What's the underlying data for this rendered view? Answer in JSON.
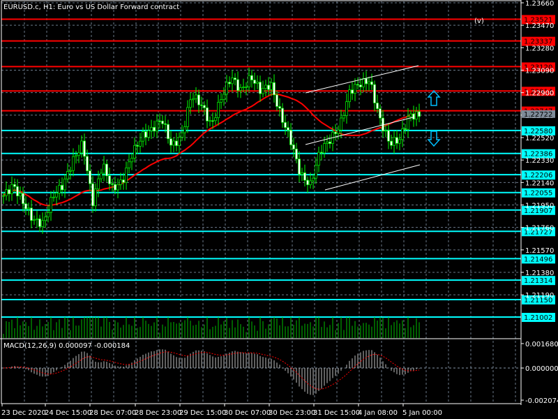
{
  "header": {
    "title": "EURUSD.c, H1:  Euro vs US Dollar Forward contract",
    "mode_indicator": "(v)"
  },
  "price_axis": {
    "ticks": [
      "1.23660",
      "1.23470",
      "1.23280",
      "1.23090",
      "1.22900",
      "1.22710",
      "1.22520",
      "1.22330",
      "1.22140",
      "1.21950",
      "1.21760",
      "1.21570",
      "1.21380",
      "1.21190"
    ],
    "current_price": "1.22722"
  },
  "levels": {
    "resistance": [
      "1.23521",
      "1.23337",
      "1.23120",
      "1.22914",
      "1.22747"
    ],
    "support": [
      "1.22580",
      "1.22386",
      "1.22206",
      "1.22055",
      "1.21907",
      "1.21727",
      "1.21496",
      "1.21314",
      "1.21150",
      "1.21002"
    ],
    "resistance_color": "#ff0000",
    "support_color": "#00ffff"
  },
  "macd": {
    "label": "MACD(12,26,9) 0.000097 -0.000184",
    "ticks": [
      "0.001680",
      "0.000000",
      "-0.002074"
    ]
  },
  "time_axis": [
    "23 Dec 2020",
    "24 Dec 15:00",
    "28 Dec 07:00",
    "28 Dec 23:00",
    "29 Dec 15:00",
    "30 Dec 07:00",
    "30 Dec 23:00",
    "31 Dec 15:00",
    "4 Jan 08:00",
    "5 Jan 00:00"
  ],
  "chart_data": {
    "type": "candlestick",
    "symbol": "EURUSD.c",
    "timeframe": "H1",
    "ylim": [
      1.21,
      1.2366
    ],
    "close_path": [
      1.22029,
      1.22117,
      1.2197,
      1.21822,
      1.21792,
      1.22029,
      1.22117,
      1.22324,
      1.22472,
      1.2197,
      1.22295,
      1.22088,
      1.22147,
      1.22383,
      1.22531,
      1.2259,
      1.22679,
      1.22443,
      1.22531,
      1.22886,
      1.22797,
      1.2262,
      1.22856,
      1.23034,
      1.22915,
      1.23034,
      1.22915,
      1.22974,
      1.22708,
      1.22502,
      1.22206,
      1.22117,
      1.22413,
      1.22502,
      1.2262,
      1.22915,
      1.22974,
      1.23004,
      1.22679,
      1.22472,
      1.22502,
      1.22708,
      1.22708
    ]
  }
}
